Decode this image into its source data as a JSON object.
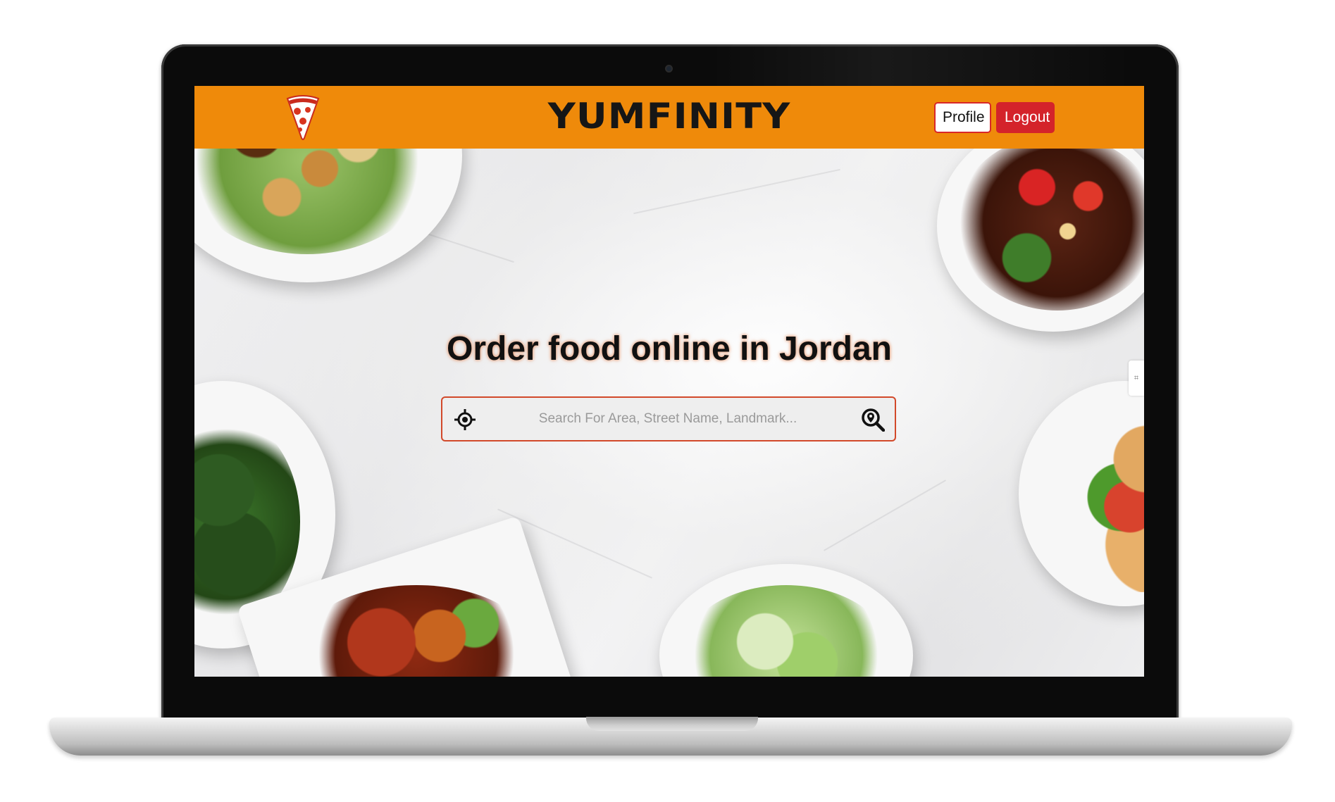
{
  "navbar": {
    "brand": "YUMFINITY",
    "profile_label": "Profile",
    "logout_label": "Logout",
    "logo_icon": "pizza-slice-icon",
    "color": "#ef8a0a"
  },
  "hero": {
    "headline": "Order food online in Jordan",
    "search": {
      "placeholder": "Search For Area, Street Name, Landmark...",
      "value": "",
      "left_icon": "locate-crosshair-icon",
      "right_icon": "search-location-icon"
    }
  },
  "colors": {
    "accent": "#ef8a0a",
    "danger": "#d4232a",
    "search_border": "#d2492a"
  }
}
